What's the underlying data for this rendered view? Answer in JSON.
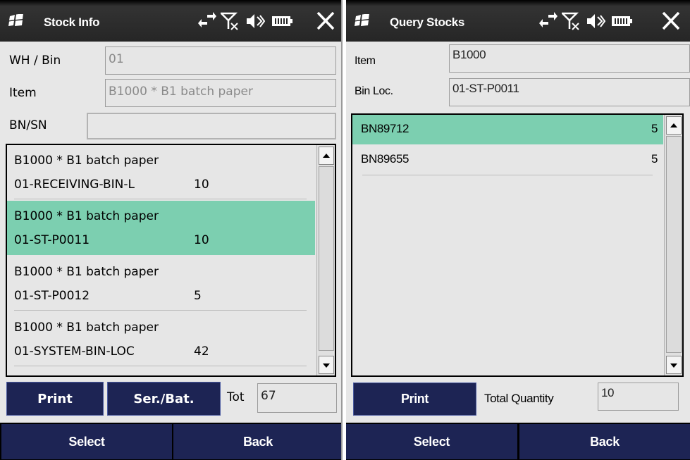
{
  "left": {
    "title": "Stock Info",
    "fields": {
      "wh_bin_label": "WH / Bin",
      "wh_bin_value": "01",
      "item_label": "Item",
      "item_value": "B1000 * B1 batch paper",
      "bnsn_label": "BN/SN",
      "bnsn_value": ""
    },
    "list": [
      {
        "line1": "B1000 * B1 batch paper",
        "bin": "01-RECEIVING-BIN-L",
        "qty": "10",
        "selected": false
      },
      {
        "line1": "B1000 * B1 batch paper",
        "bin": "01-ST-P0011",
        "qty": "10",
        "selected": true
      },
      {
        "line1": "B1000 * B1 batch paper",
        "bin": "01-ST-P0012",
        "qty": "5",
        "selected": false
      },
      {
        "line1": "B1000 * B1 batch paper",
        "bin": "01-SYSTEM-BIN-LOC",
        "qty": "42",
        "selected": false
      }
    ],
    "buttons": {
      "print": "Print",
      "ser_bat": "Ser./Bat."
    },
    "tot_label": "Tot",
    "tot_value": "67",
    "softkeys": {
      "select": "Select",
      "back": "Back"
    }
  },
  "right": {
    "title": "Query Stocks",
    "fields": {
      "item_label": "Item",
      "item_value": "B1000",
      "binloc_label": "Bin Loc.",
      "binloc_value": "01-ST-P0011"
    },
    "list": [
      {
        "batch": "BN89712",
        "qty": "5",
        "selected": true
      },
      {
        "batch": "BN89655",
        "qty": "5",
        "selected": false
      }
    ],
    "buttons": {
      "print": "Print"
    },
    "total_label": "Total Quantity",
    "total_value": "10",
    "softkeys": {
      "select": "Select",
      "back": "Back"
    }
  },
  "colors": {
    "selection": "#7ccfb0",
    "button": "#1d2454",
    "titlebar": "#262626"
  },
  "icons": [
    "windows-flag-icon",
    "sync-arrows-icon",
    "no-signal-icon",
    "speaker-icon",
    "battery-icon",
    "close-icon",
    "scroll-up-icon",
    "scroll-down-icon"
  ]
}
